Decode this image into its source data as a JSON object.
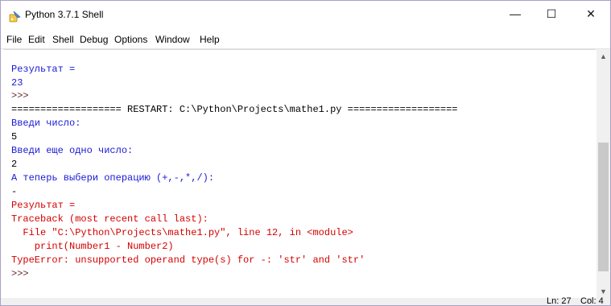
{
  "window": {
    "title": "Python 3.7.1 Shell",
    "minimize_label": "—",
    "maximize_label": "☐",
    "close_label": "✕"
  },
  "menu": [
    "File",
    "Edit",
    "Shell",
    "Debug",
    "Options",
    "Window",
    "Help"
  ],
  "shell_lines": [
    {
      "text": "Результат =",
      "kind": "blue"
    },
    {
      "text": "23",
      "kind": "blue"
    },
    {
      "text": ">>>",
      "kind": "prompt"
    },
    {
      "text": "=================== RESTART: C:\\Python\\Projects\\mathe1.py ===================",
      "kind": "out"
    },
    {
      "text": "Введи число:",
      "kind": "blue"
    },
    {
      "text": "5",
      "kind": "out"
    },
    {
      "text": "Введи еще одно число:",
      "kind": "blue"
    },
    {
      "text": "2",
      "kind": "out"
    },
    {
      "text": "А теперь выбери операцию (+,-,*,/):",
      "kind": "blue"
    },
    {
      "text": "-",
      "kind": "out"
    },
    {
      "text": "Результат =",
      "kind": "red"
    },
    {
      "text": "Traceback (most recent call last):",
      "kind": "red"
    },
    {
      "text": "  File \"C:\\Python\\Projects\\mathe1.py\", line 12, in <module>",
      "kind": "red"
    },
    {
      "text": "    print(Number1 - Number2)",
      "kind": "red"
    },
    {
      "text": "TypeError: unsupported operand type(s) for -: 'str' and 'str'",
      "kind": "red"
    },
    {
      "text": ">>>",
      "kind": "prompt"
    }
  ],
  "status": {
    "line": "Ln: 27",
    "col": "Col: 4"
  },
  "colors": {
    "output_blue": "#1a1ad6",
    "error_red": "#d40000",
    "prompt": "#6a2a2a"
  },
  "icons": {
    "app": "python-idle-icon",
    "scroll_up": "chevron-up-icon",
    "scroll_down": "chevron-down-icon"
  }
}
